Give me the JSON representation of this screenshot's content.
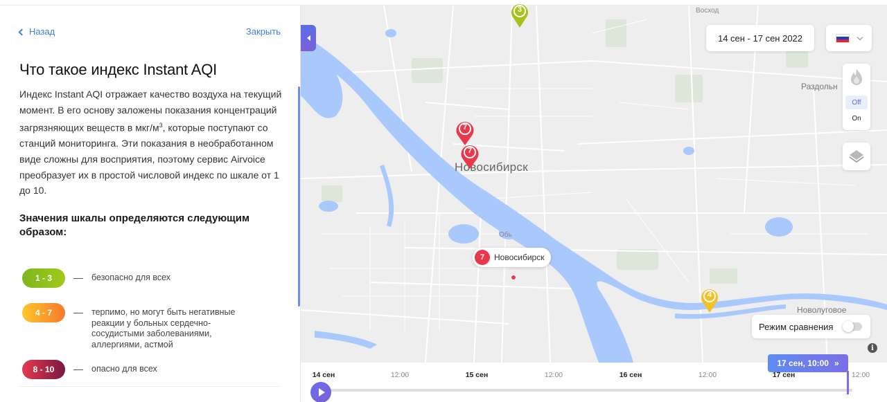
{
  "panel": {
    "back_label": "Назад",
    "close_label": "Закрыть",
    "title": "Что такое индекс Instant AQI",
    "text_before_sup": "Индекс Instant AQI отражает качество воздуха на текущий момент. В его основу заложены показания концентраций загрязняющих веществ в мкг/м",
    "text_sup": "3",
    "text_after_sup": ", которые поступают со станций мониторинга. Эти показания в необработанном виде сложны для восприятия, поэтому сервис Airvoice преобразует их в простой числовой индекс по шкале от 1 до 10.",
    "scale_title": "Значения шкалы определяются следующим образом:",
    "legend": [
      {
        "range": "1 - 3",
        "text": "безопасно для всех",
        "color_from": "#7cb71d",
        "color_to": "#a3c91a"
      },
      {
        "range": "4 - 7",
        "text": "терпимо, но могут быть негативные реакции у больных сердечно-сосудистыми заболеваниями, аллергиями, астмой",
        "color_from": "#ffc62a",
        "color_to": "#f57a2c"
      },
      {
        "range": "8 - 10",
        "text": "опасно для всех",
        "color_from": "#e43a4e",
        "color_to": "#7a1740"
      }
    ]
  },
  "map": {
    "city_label": "Новосибирск",
    "places": {
      "voskhod": "Восход",
      "razdolnoe": "Раздольн",
      "novolugovoe": "Новолуговое",
      "ob": "Обь"
    },
    "date_range": "14 сен - 17 сен 2022",
    "fire_off": "Off",
    "fire_on": "On",
    "compare_label": "Режим сравнения",
    "info_glyph": "i",
    "markers": [
      {
        "value": "3",
        "color": "#a3c21a"
      },
      {
        "value": "7",
        "color": "#e8384a"
      },
      {
        "value": "7",
        "color": "#e8384a"
      },
      {
        "value": "4",
        "color": "#f4c024"
      }
    ],
    "station": {
      "value": "7",
      "name": "Новосибирск"
    },
    "colors": {
      "water": "#a9c8fb",
      "land": "#eeeeee",
      "road": "#ffffff",
      "park": "#dfe6dc"
    }
  },
  "timeline": {
    "ticks": [
      "14 сен",
      "12:00",
      "15 сен",
      "12:00",
      "16 сен",
      "12:00",
      "17 сен",
      "12:00"
    ],
    "current": "17 сен, 10:00",
    "current_arrow": "»"
  }
}
